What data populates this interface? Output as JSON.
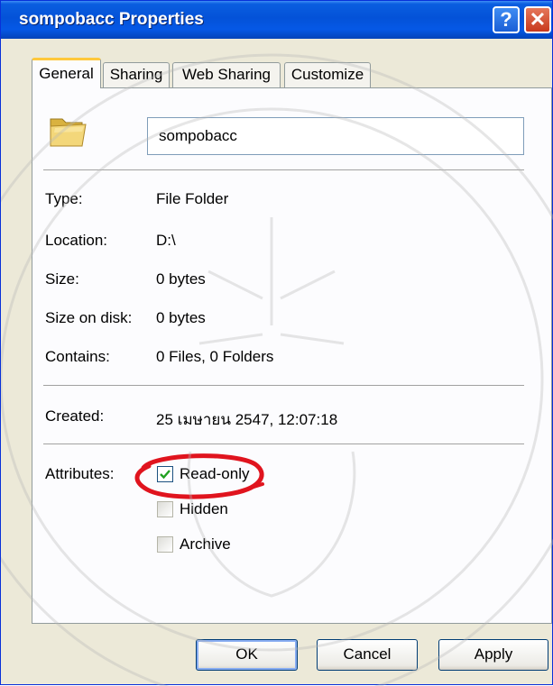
{
  "window": {
    "title": "sompobacc Properties"
  },
  "titlebar": {
    "help_icon": "?",
    "close_icon": "✕"
  },
  "tabs": [
    {
      "label": "General",
      "active": true
    },
    {
      "label": "Sharing",
      "active": false
    },
    {
      "label": "Web Sharing",
      "active": false
    },
    {
      "label": "Customize",
      "active": false
    }
  ],
  "general": {
    "icon": "folder-icon",
    "name_value": "sompobacc",
    "fields": [
      {
        "label": "Type:",
        "value": "File Folder"
      },
      {
        "label": "Location:",
        "value": "D:\\"
      },
      {
        "label": "Size:",
        "value": "0 bytes"
      },
      {
        "label": "Size on disk:",
        "value": "0 bytes"
      },
      {
        "label": "Contains:",
        "value": "0 Files, 0 Folders"
      }
    ],
    "created": {
      "label": "Created:",
      "value": "25 เมษายน 2547, 12:07:18"
    },
    "attributes": {
      "label": "Attributes:",
      "items": [
        {
          "label": "Read-only",
          "checked": true
        },
        {
          "label": "Hidden",
          "checked": false
        },
        {
          "label": "Archive",
          "checked": false
        }
      ]
    }
  },
  "buttons": {
    "ok": "OK",
    "cancel": "Cancel",
    "apply": "Apply"
  },
  "colors": {
    "titlebar": "#0452d8",
    "annotation": "#e0141e",
    "panel": "#fcfcfe",
    "window": "#ECE9D8"
  }
}
